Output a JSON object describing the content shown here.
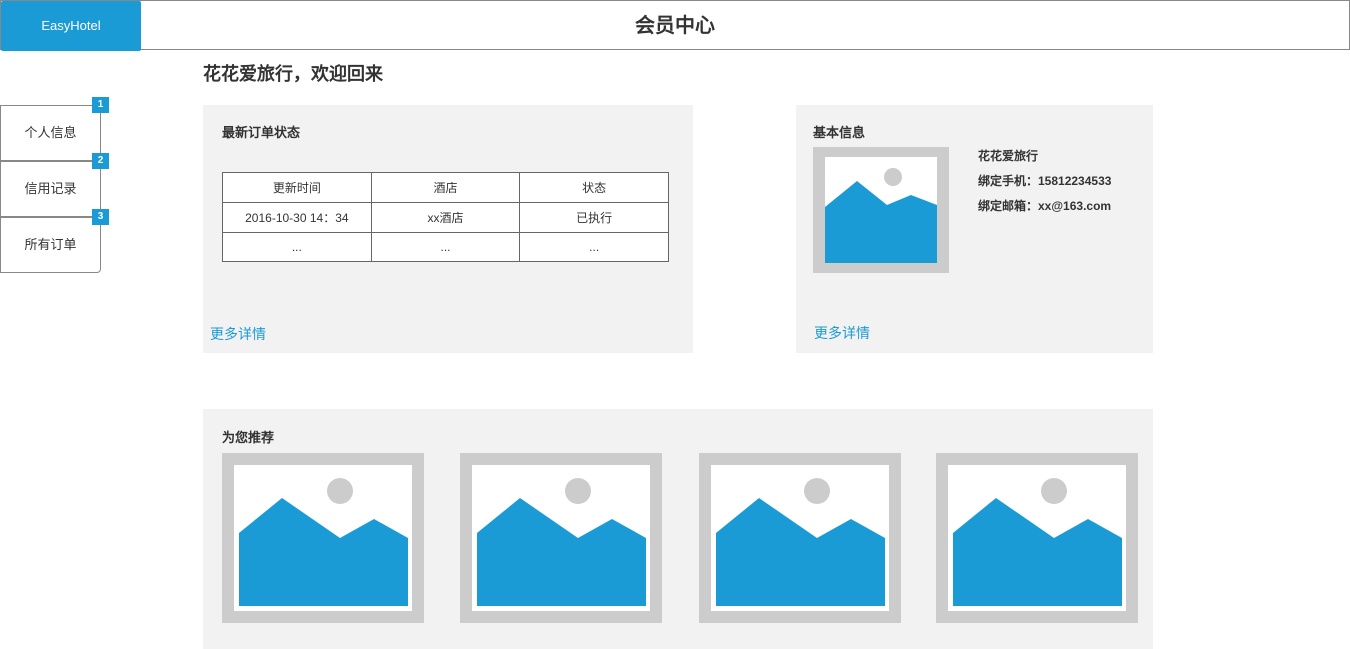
{
  "header": {
    "logo": "EasyHotel",
    "title": "会员中心"
  },
  "welcome": "花花爱旅行，欢迎回来",
  "sidebar": {
    "items": [
      {
        "badge": "1",
        "label": "个人信息"
      },
      {
        "badge": "2",
        "label": "信用记录"
      },
      {
        "badge": "3",
        "label": "所有订单"
      }
    ]
  },
  "orders_panel": {
    "title": "最新订单状态",
    "columns": [
      "更新时间",
      "酒店",
      "状态"
    ],
    "rows": [
      [
        "2016-10-30 14：34",
        "xx酒店",
        "已执行"
      ],
      [
        "...",
        "...",
        "..."
      ]
    ],
    "more": "更多详情"
  },
  "info_panel": {
    "title": "基本信息",
    "username": "花花爱旅行",
    "phone": "绑定手机：15812234533",
    "email": "绑定邮箱：xx@163.com",
    "more": "更多详情"
  },
  "recommend_panel": {
    "title": "为您推荐",
    "items": [
      "image-placeholder",
      "image-placeholder",
      "image-placeholder",
      "image-placeholder"
    ]
  },
  "colors": {
    "accent": "#1a9bd6",
    "panel_bg": "#f2f2f2",
    "placeholder_frame": "#cccccc"
  }
}
